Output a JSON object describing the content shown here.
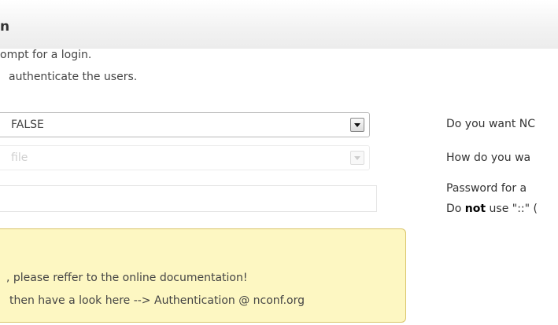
{
  "header": {
    "title": "n",
    "desc_line1": "ompt for a login.",
    "desc_line2": "authenticate the users."
  },
  "form": {
    "auth_select": {
      "value": "FALSE"
    },
    "auth_type_select": {
      "value": "file"
    },
    "password_input": {
      "value": ""
    }
  },
  "help": {
    "auth_enable": "Do you want NC",
    "auth_type": "How do you wa",
    "password_line1": "Password for a",
    "password_line2_pre": "Do ",
    "password_line2_bold": "not",
    "password_line2_post": " use \"::\" ("
  },
  "notice": {
    "line1": ", please reffer to the online documentation!",
    "line2": "then have a look here --> Authentication @ nconf.org",
    "link_text": "Authentication @ nconf.org"
  },
  "colors": {
    "notice_bg": "#fdf7c2",
    "notice_border": "#d9c46a"
  }
}
